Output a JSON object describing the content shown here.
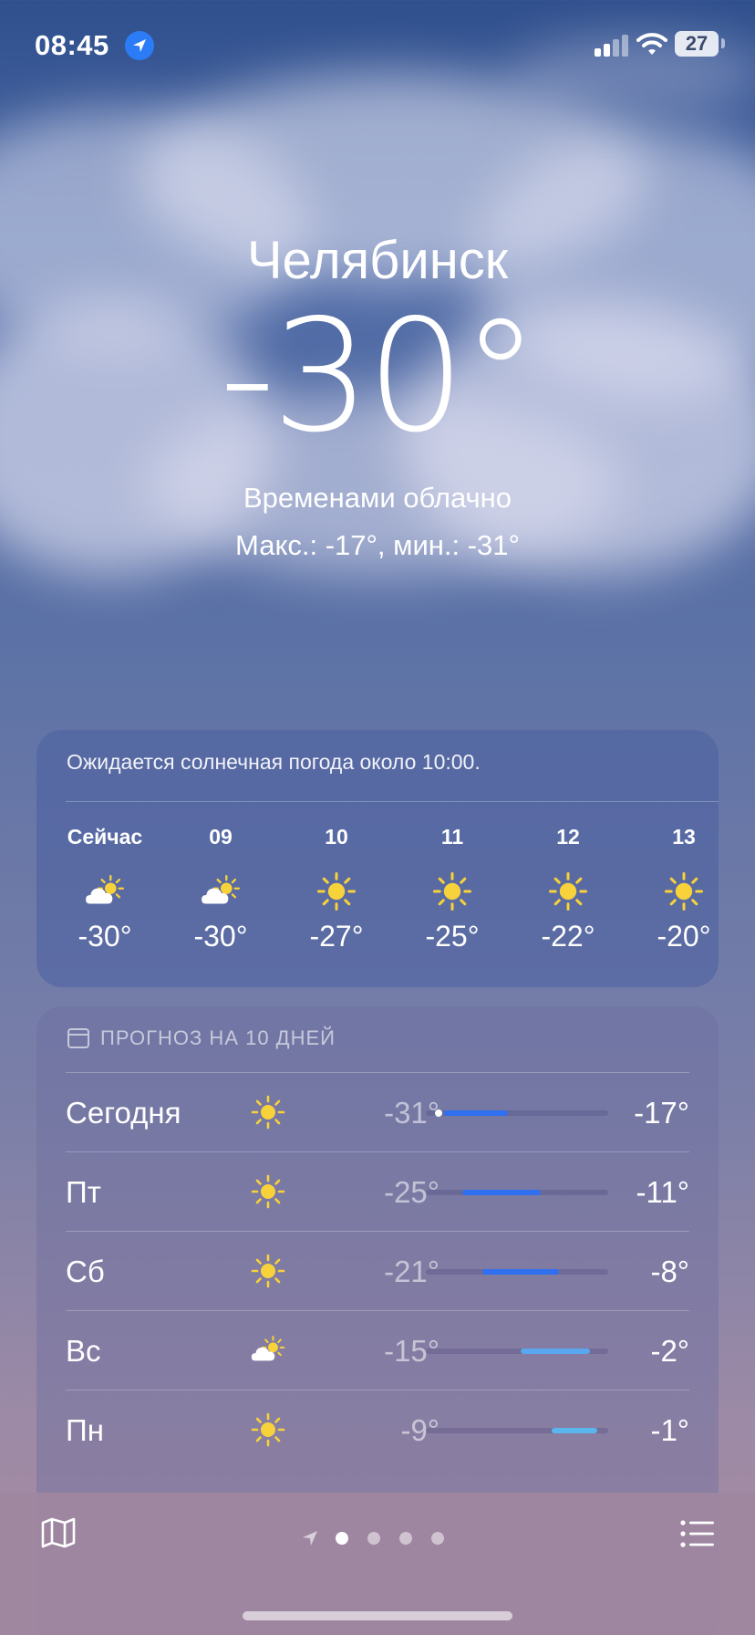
{
  "status_bar": {
    "time": "08:45",
    "battery": "27"
  },
  "hero": {
    "city": "Челябинск",
    "temperature": "-30°",
    "condition": "Временами облачно",
    "high_low": "Макс.: -17°, мин.: -31°"
  },
  "hourly": {
    "note": "Ожидается солнечная погода около 10:00.",
    "hours": [
      {
        "label": "Сейчас",
        "icon": "partly-cloudy-icon",
        "temp": "-30°"
      },
      {
        "label": "09",
        "icon": "partly-cloudy-icon",
        "temp": "-30°"
      },
      {
        "label": "10",
        "icon": "sun-icon",
        "temp": "-27°"
      },
      {
        "label": "11",
        "icon": "sun-icon",
        "temp": "-25°"
      },
      {
        "label": "12",
        "icon": "sun-icon",
        "temp": "-22°"
      },
      {
        "label": "13",
        "icon": "sun-icon",
        "temp": "-20°"
      }
    ]
  },
  "daily": {
    "header": "ПРОГНОЗ НА 10 ДНЕЙ",
    "days": [
      {
        "day": "Сегодня",
        "icon": "sun-icon",
        "low": "-31°",
        "high": "-17°",
        "range_start": 0.1,
        "range_end": 0.45,
        "current": 0.05,
        "color": "#2f6ff0"
      },
      {
        "day": "Пт",
        "icon": "sun-icon",
        "low": "-25°",
        "high": "-11°",
        "range_start": 0.2,
        "range_end": 0.63,
        "color": "#2f6ff0"
      },
      {
        "day": "Сб",
        "icon": "sun-icon",
        "low": "-21°",
        "high": "-8°",
        "range_start": 0.31,
        "range_end": 0.73,
        "color": "#2f6ff0"
      },
      {
        "day": "Вс",
        "icon": "partly-cloudy-icon",
        "low": "-15°",
        "high": "-2°",
        "range_start": 0.52,
        "range_end": 0.9,
        "color": "#5aa6ef"
      },
      {
        "day": "Пн",
        "icon": "sun-icon",
        "low": "-9°",
        "high": "-1°",
        "range_start": 0.69,
        "range_end": 0.94,
        "color": "#5ab6ec"
      }
    ]
  },
  "colors": {
    "sun": "#f7d23a",
    "cloud": "#ffffff"
  },
  "bottom_bar": {
    "page_count": 4,
    "active_page": 0
  }
}
